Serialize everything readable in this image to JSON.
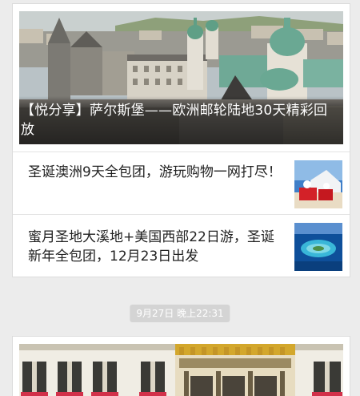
{
  "feed": {
    "article_group_1": {
      "cover_title": "【悦分享】萨尔斯堡——欧洲邮轮陆地30天精彩回放",
      "cover_image_icon": "city-panorama-image",
      "items": [
        {
          "title": "圣诞澳洲9天全包团，游玩购物一网打尽！",
          "thumb_icon": "santa-beach-thumbnail"
        },
        {
          "title": "蜜月圣地大溪地+美国西部22日游，圣诞新年全包团，12月23日出发",
          "thumb_icon": "island-lagoon-thumbnail"
        }
      ]
    },
    "timestamp": "9月27日 晚上22:31",
    "article_group_2": {
      "cover_image_icon": "golden-roof-building-image"
    }
  }
}
